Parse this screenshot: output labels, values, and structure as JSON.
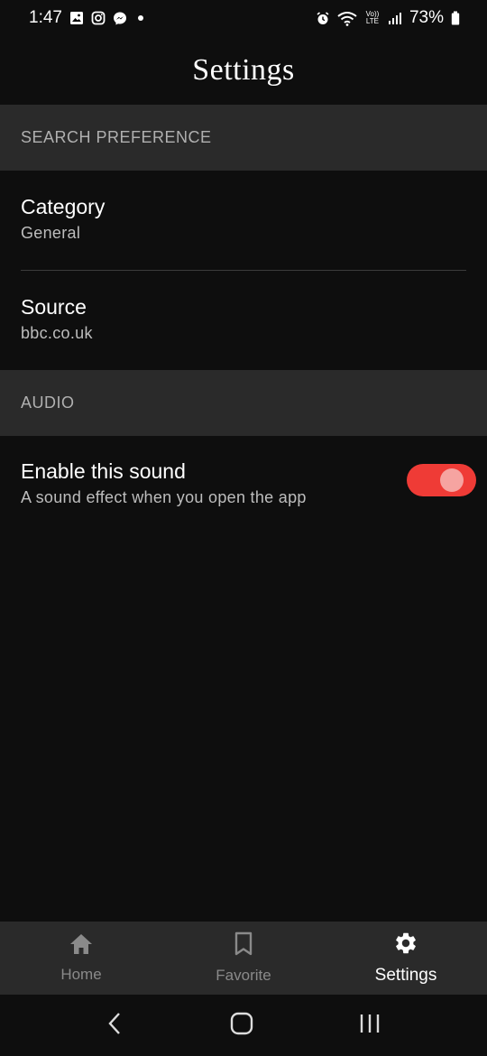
{
  "status_bar": {
    "time": "1:47",
    "battery": "73%",
    "notification_icons": [
      "gallery-icon",
      "instagram-icon",
      "messenger-icon",
      "dot-icon"
    ],
    "system_icons": [
      "alarm-icon",
      "wifi-icon",
      "volte-icon",
      "signal-icon",
      "battery-icon"
    ],
    "volte_label": "Vo)) LTE"
  },
  "header": {
    "title": "Settings"
  },
  "sections": {
    "search": {
      "label": "SEARCH PREFERENCE"
    },
    "audio": {
      "label": "AUDIO"
    }
  },
  "category": {
    "title": "Category",
    "value": "General"
  },
  "source": {
    "title": "Source",
    "value": "bbc.co.uk"
  },
  "sound": {
    "title": "Enable this sound",
    "subtitle": "A sound effect when you open the app",
    "enabled": true
  },
  "bottom_nav": {
    "items": [
      {
        "label": "Home",
        "icon": "home-icon",
        "active": false
      },
      {
        "label": "Favorite",
        "icon": "bookmark-icon",
        "active": false
      },
      {
        "label": "Settings",
        "icon": "gear-icon",
        "active": true
      }
    ]
  },
  "system_nav": {
    "icons": [
      "back-icon",
      "home-circle-icon",
      "recents-icon"
    ]
  },
  "colors": {
    "background": "#0e0e0e",
    "section_bg": "#2a2a2a",
    "accent": "#ef3b36",
    "toggle_knob": "#f6a4a1",
    "muted_text": "#8a8a8a"
  }
}
